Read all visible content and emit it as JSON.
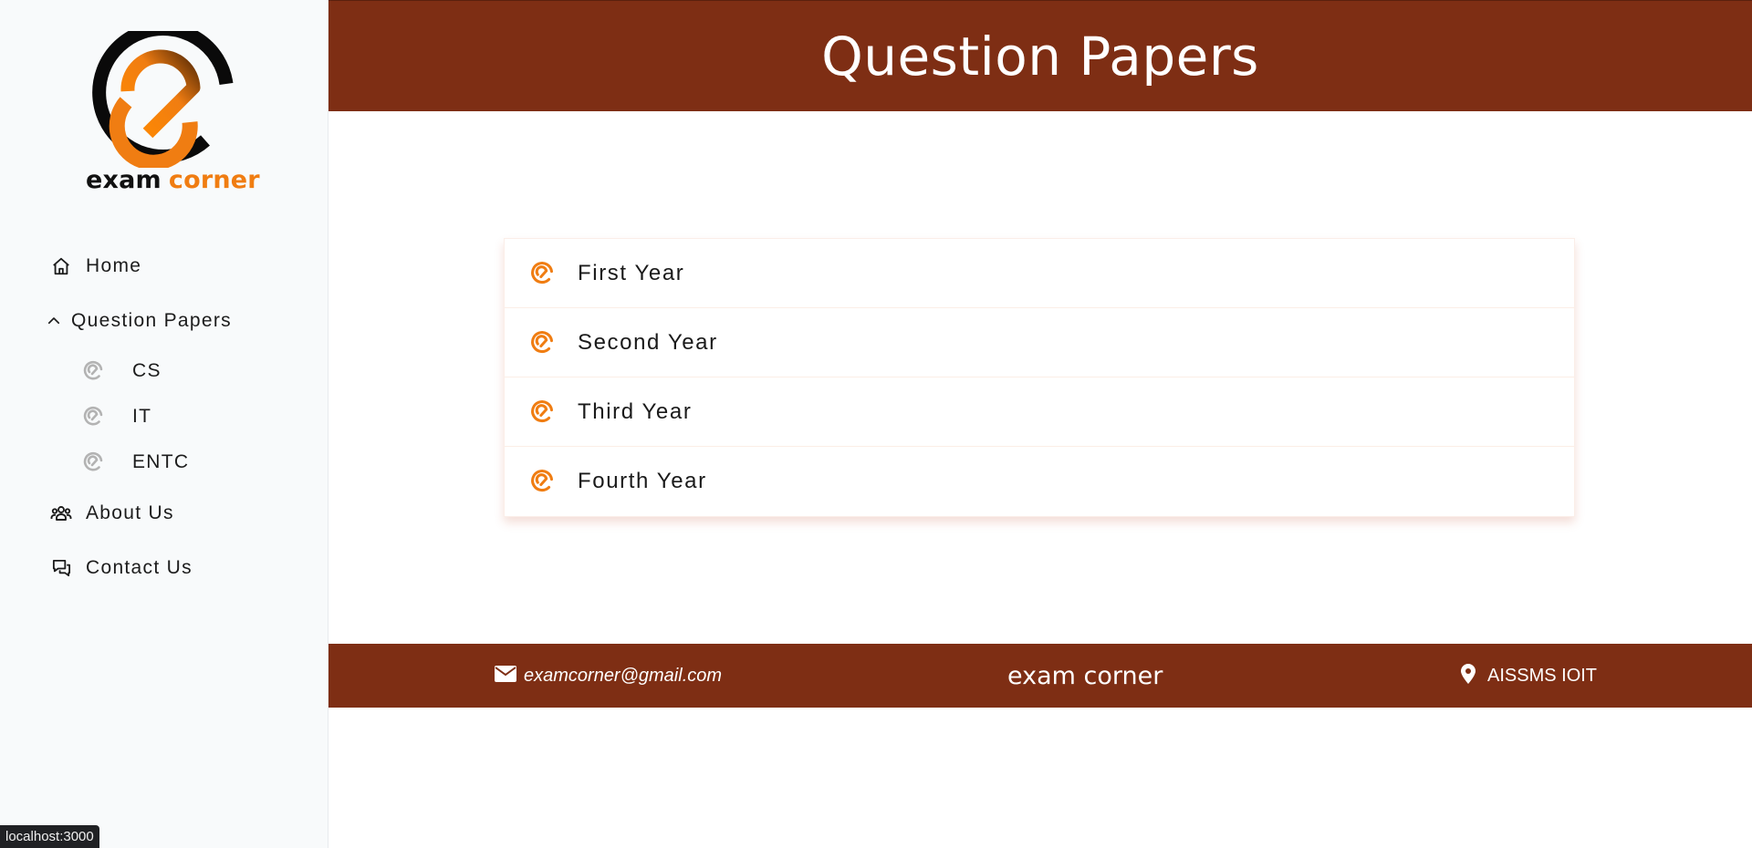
{
  "logo": {
    "word1": "exam",
    "word2": "corner",
    "colors": {
      "dark": "#0a0a0a",
      "orange": "#f07d12"
    }
  },
  "sidebar": {
    "home": {
      "label": "Home",
      "icon": "home-icon"
    },
    "question_papers": {
      "label": "Question Papers",
      "icon": "chevron-up-icon",
      "expanded": true,
      "children": [
        {
          "label": "CS",
          "icon": "e-logo-icon"
        },
        {
          "label": "IT",
          "icon": "e-logo-icon"
        },
        {
          "label": "ENTC",
          "icon": "e-logo-icon"
        }
      ]
    },
    "about": {
      "label": "About Us",
      "icon": "users-icon"
    },
    "contact": {
      "label": "Contact Us",
      "icon": "chat-icon"
    }
  },
  "header": {
    "title": "Question Papers"
  },
  "years": [
    {
      "label": "First Year",
      "icon": "e-logo-icon"
    },
    {
      "label": "Second Year",
      "icon": "e-logo-icon"
    },
    {
      "label": "Third Year",
      "icon": "e-logo-icon"
    },
    {
      "label": "Fourth Year",
      "icon": "e-logo-icon"
    }
  ],
  "footer": {
    "email": "examcorner@gmail.com",
    "brand": "exam corner",
    "location": "AISSMS IOIT"
  },
  "status_bar": {
    "text": "localhost:3000"
  },
  "colors": {
    "header_bg": "#7e2e14",
    "accent_orange": "#f07d12",
    "sidebar_bg": "#f8fafb",
    "sub_icon_gray": "#b3b3b3"
  }
}
